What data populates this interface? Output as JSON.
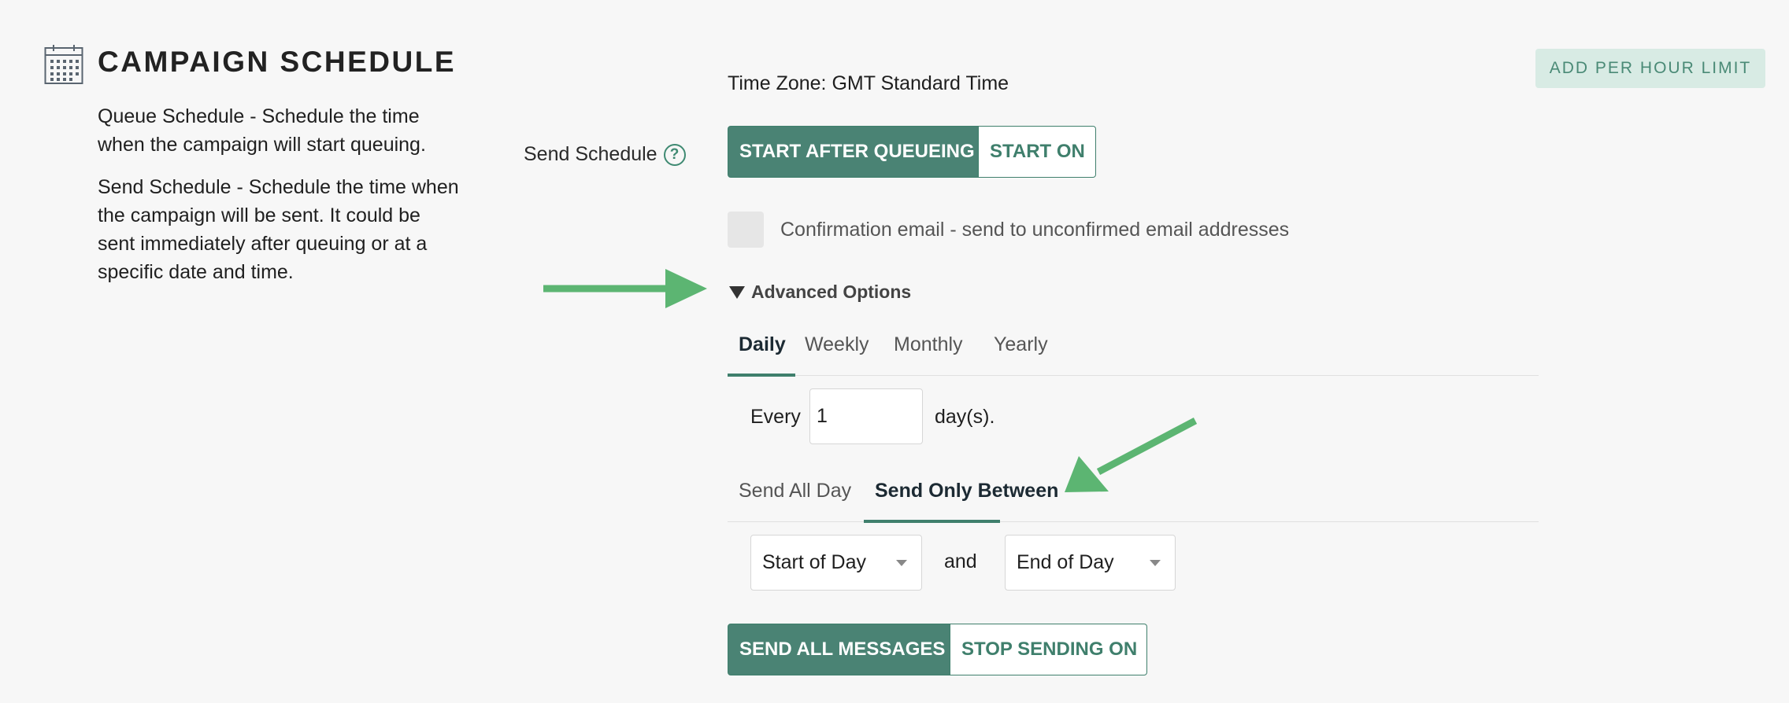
{
  "section": {
    "icon": "calendar-icon",
    "title": "CAMPAIGN SCHEDULE",
    "queue_desc": "Queue Schedule - Schedule the time when the campaign will start queuing.",
    "send_desc": "Send Schedule - Schedule the time when the campaign will be sent. It could be sent immediately after queuing or at a specific date and time."
  },
  "add_limit_label": "ADD PER HOUR LIMIT",
  "timezone": "Time Zone: GMT Standard Time",
  "send_schedule": {
    "label": "Send Schedule",
    "help_icon": "question-circle-icon",
    "help_glyph": "?",
    "options": [
      "START AFTER QUEUEING",
      "START ON"
    ],
    "selected": "START AFTER QUEUEING"
  },
  "confirmation": {
    "label": "Confirmation email - send to unconfirmed email addresses",
    "checked": false
  },
  "advanced": {
    "label": "Advanced Options",
    "icon": "triangle-down-icon"
  },
  "recurrence_tabs": {
    "items": [
      "Daily",
      "Weekly",
      "Monthly",
      "Yearly"
    ],
    "selected": "Daily"
  },
  "every": {
    "label": "Every",
    "value": "1",
    "unit": "day(s)."
  },
  "window_tabs": {
    "items": [
      "Send All Day",
      "Send Only Between"
    ],
    "selected": "Send Only Between"
  },
  "time_range": {
    "start": "Start of Day",
    "and": "and",
    "end": "End of Day"
  },
  "send_mode": {
    "options": [
      "SEND ALL MESSAGES",
      "STOP SENDING ON"
    ],
    "selected": "SEND ALL MESSAGES"
  },
  "colors": {
    "accent": "#4a8374",
    "annotation_arrow": "#5cb572"
  }
}
